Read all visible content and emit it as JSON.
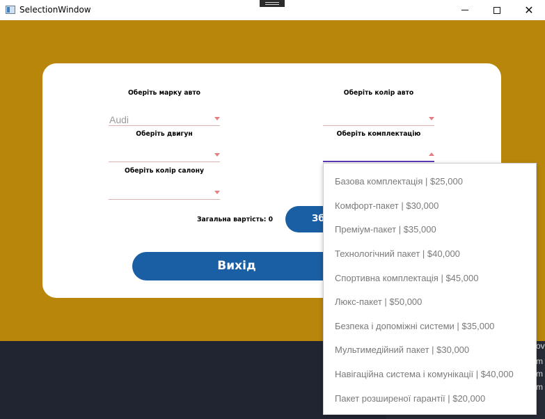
{
  "window": {
    "title": "SelectionWindow",
    "minimize_glyph": "—",
    "maximize_glyph": "☐",
    "close_glyph": "✕"
  },
  "form": {
    "brand_label": "Оберіть марку авто",
    "brand_value": "Audi",
    "color_label": "Оберіть колір авто",
    "color_value": "",
    "engine_label": "Оберіть двигун",
    "engine_value": "",
    "package_label": "Оберіть комплектацію",
    "package_value": "",
    "interior_label": "Оберіть колір салону",
    "interior_value": "",
    "total_label": "Загальна вартість: 0",
    "save_button": "Зб",
    "exit_button": "Вихід"
  },
  "dropdown": {
    "items": [
      "Базова комплектація | $25,000",
      "Комфорт-пакет | $30,000",
      "Преміум-пакет | $35,000",
      "Технологічний пакет | $40,000",
      "Спортивна комплектація | $45,000",
      "Люкс-пакет | $50,000",
      "Безпека і допоміжні системи | $35,000",
      "Мультимедійний пакет | $30,000",
      "Навігаційна система і комунікації | $40,000",
      "Пакет розширеної гарантії | $20,000"
    ]
  },
  "background_peek": [
    "ov",
    "m",
    "m",
    "m"
  ],
  "colors": {
    "window_bg": "#b8860b",
    "card_bg": "#ffffff",
    "button_bg": "#1a5ea3",
    "accent_underline": "#5a3cb0",
    "arrow": "#e08080",
    "taskbar": "#202531"
  }
}
